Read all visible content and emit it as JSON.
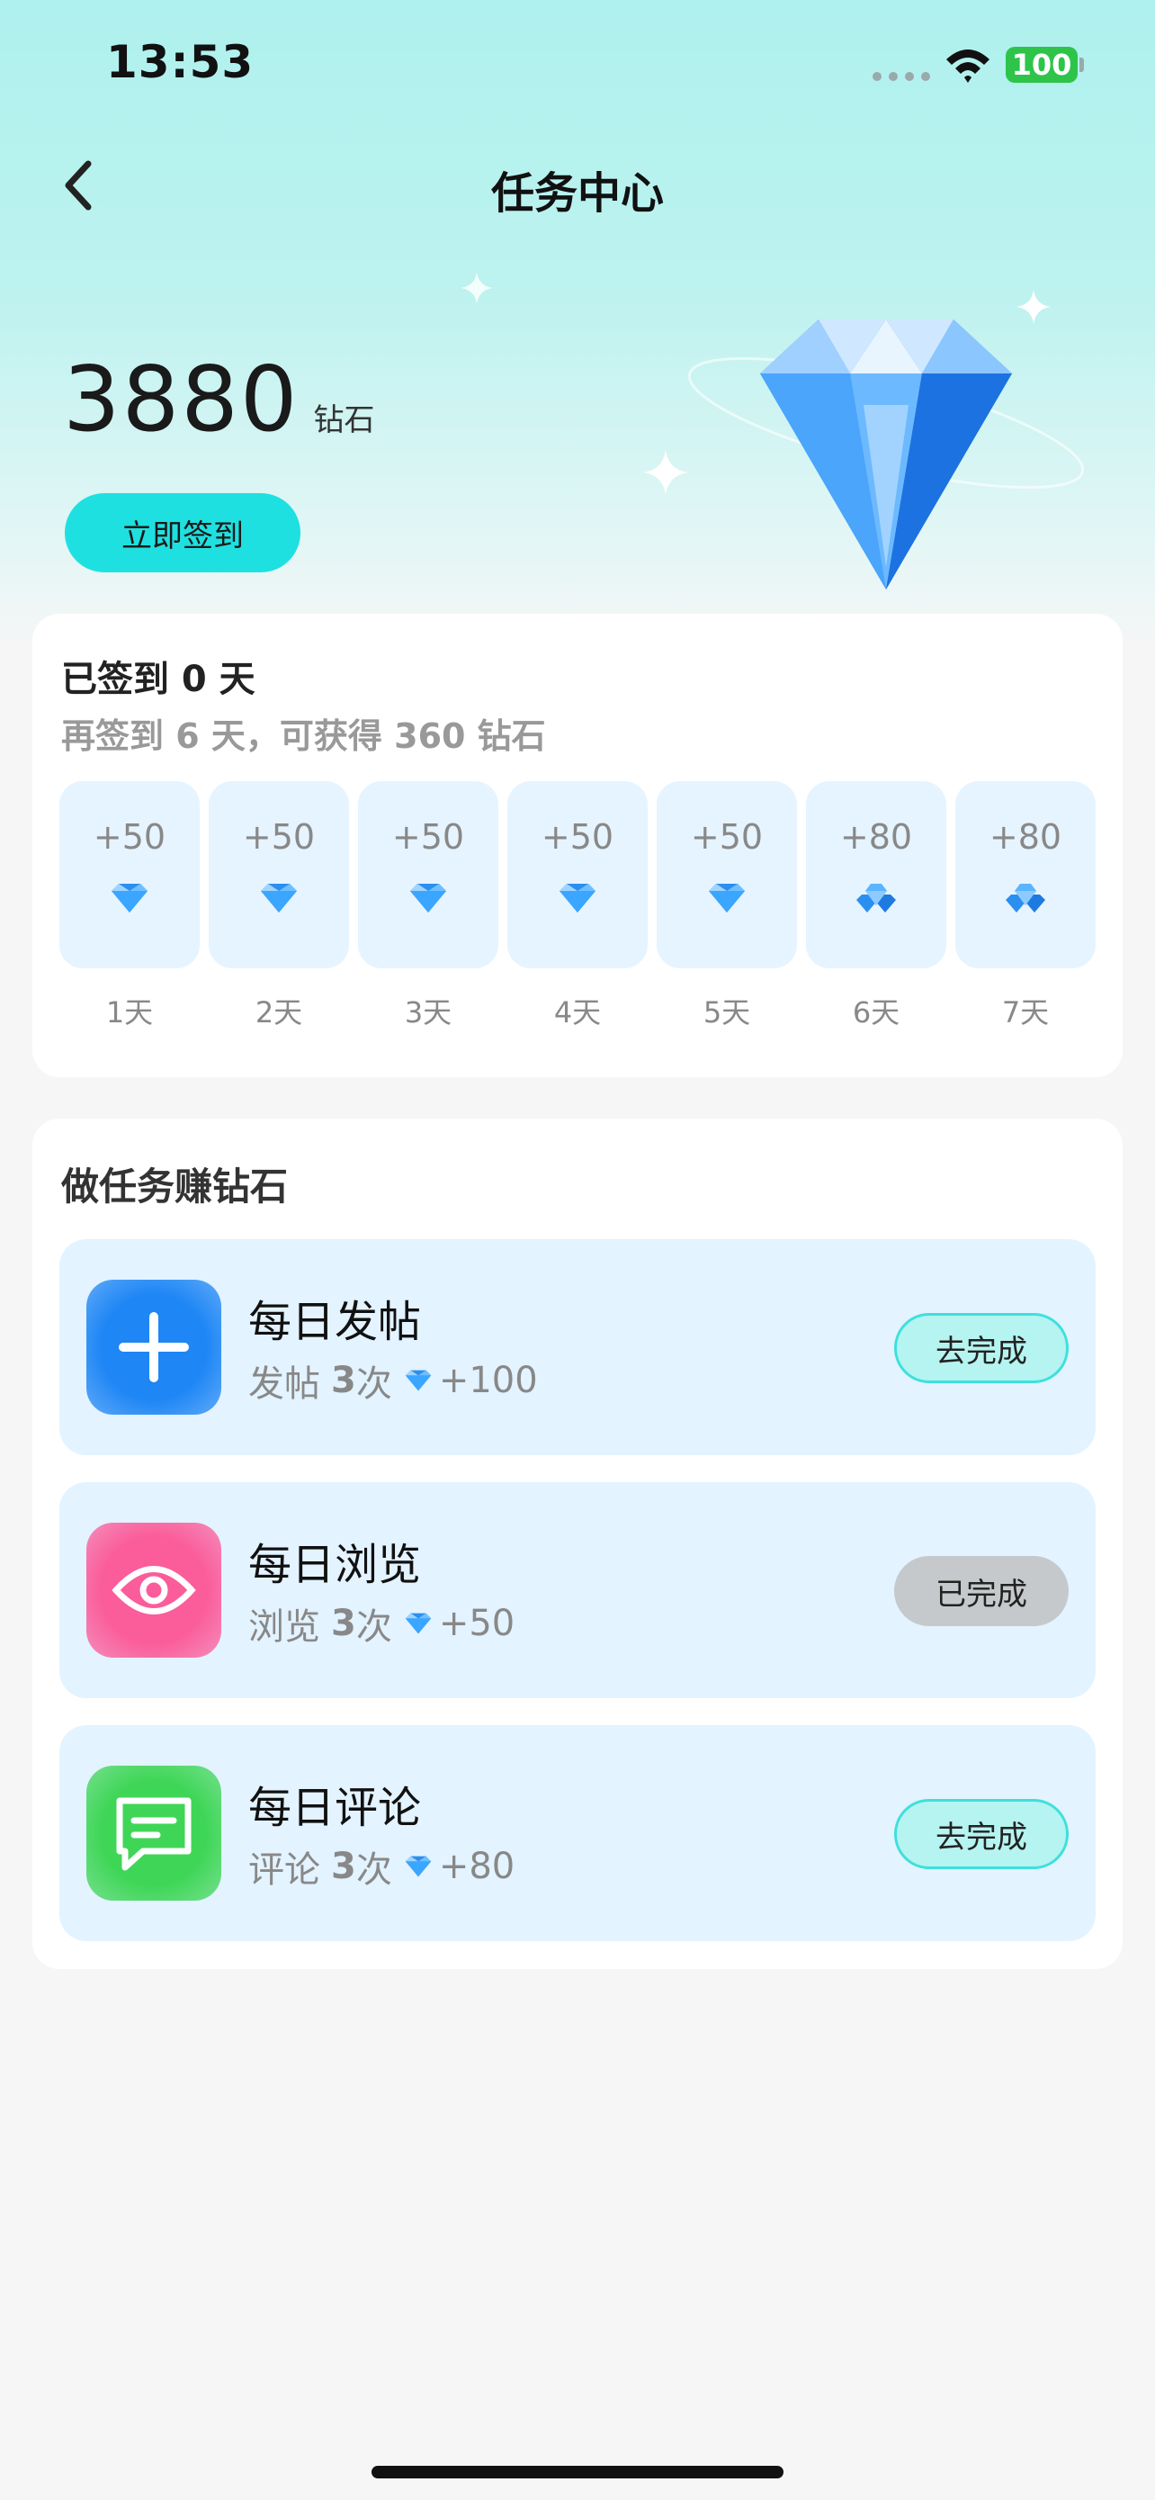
{
  "status": {
    "time": "13:53",
    "battery": "100"
  },
  "nav": {
    "title": "任务中心"
  },
  "balance": {
    "value": "3880",
    "unit": "钻石"
  },
  "checkin_button": "立即签到",
  "signin": {
    "title": "已签到 0 天",
    "subtitle": "再签到 6 天，可获得 360 钻石",
    "days": [
      {
        "reward": "+50",
        "label": "1天",
        "icon": "gem-icon"
      },
      {
        "reward": "+50",
        "label": "2天",
        "icon": "gem-icon"
      },
      {
        "reward": "+50",
        "label": "3天",
        "icon": "gem-icon"
      },
      {
        "reward": "+50",
        "label": "4天",
        "icon": "gem-icon"
      },
      {
        "reward": "+50",
        "label": "5天",
        "icon": "gem-icon"
      },
      {
        "reward": "+80",
        "label": "6天",
        "icon": "gem-pile-icon"
      },
      {
        "reward": "+80",
        "label": "7天",
        "icon": "gem-pile-icon"
      }
    ]
  },
  "tasks": {
    "title": "做任务赚钻石",
    "items": [
      {
        "name": "每日发帖",
        "action": "发帖",
        "count": "3",
        "unit": "次",
        "reward": "+100",
        "button": "去完成",
        "icon": "plus-icon",
        "color": "#1e86f5",
        "state": "todo"
      },
      {
        "name": "每日浏览",
        "action": "浏览",
        "count": "3",
        "unit": "次",
        "reward": "+50",
        "button": "已完成",
        "icon": "eye-icon",
        "color": "#fb5c9a",
        "state": "done"
      },
      {
        "name": "每日评论",
        "action": "评论",
        "count": "3",
        "unit": "次",
        "reward": "+80",
        "button": "去完成",
        "icon": "comment-icon",
        "color": "#3fd657",
        "state": "todo"
      }
    ]
  },
  "colors": {
    "accent": "#1fe0e0",
    "card_tint": "#e3f3ff",
    "done_button": "#c6c9cb"
  }
}
